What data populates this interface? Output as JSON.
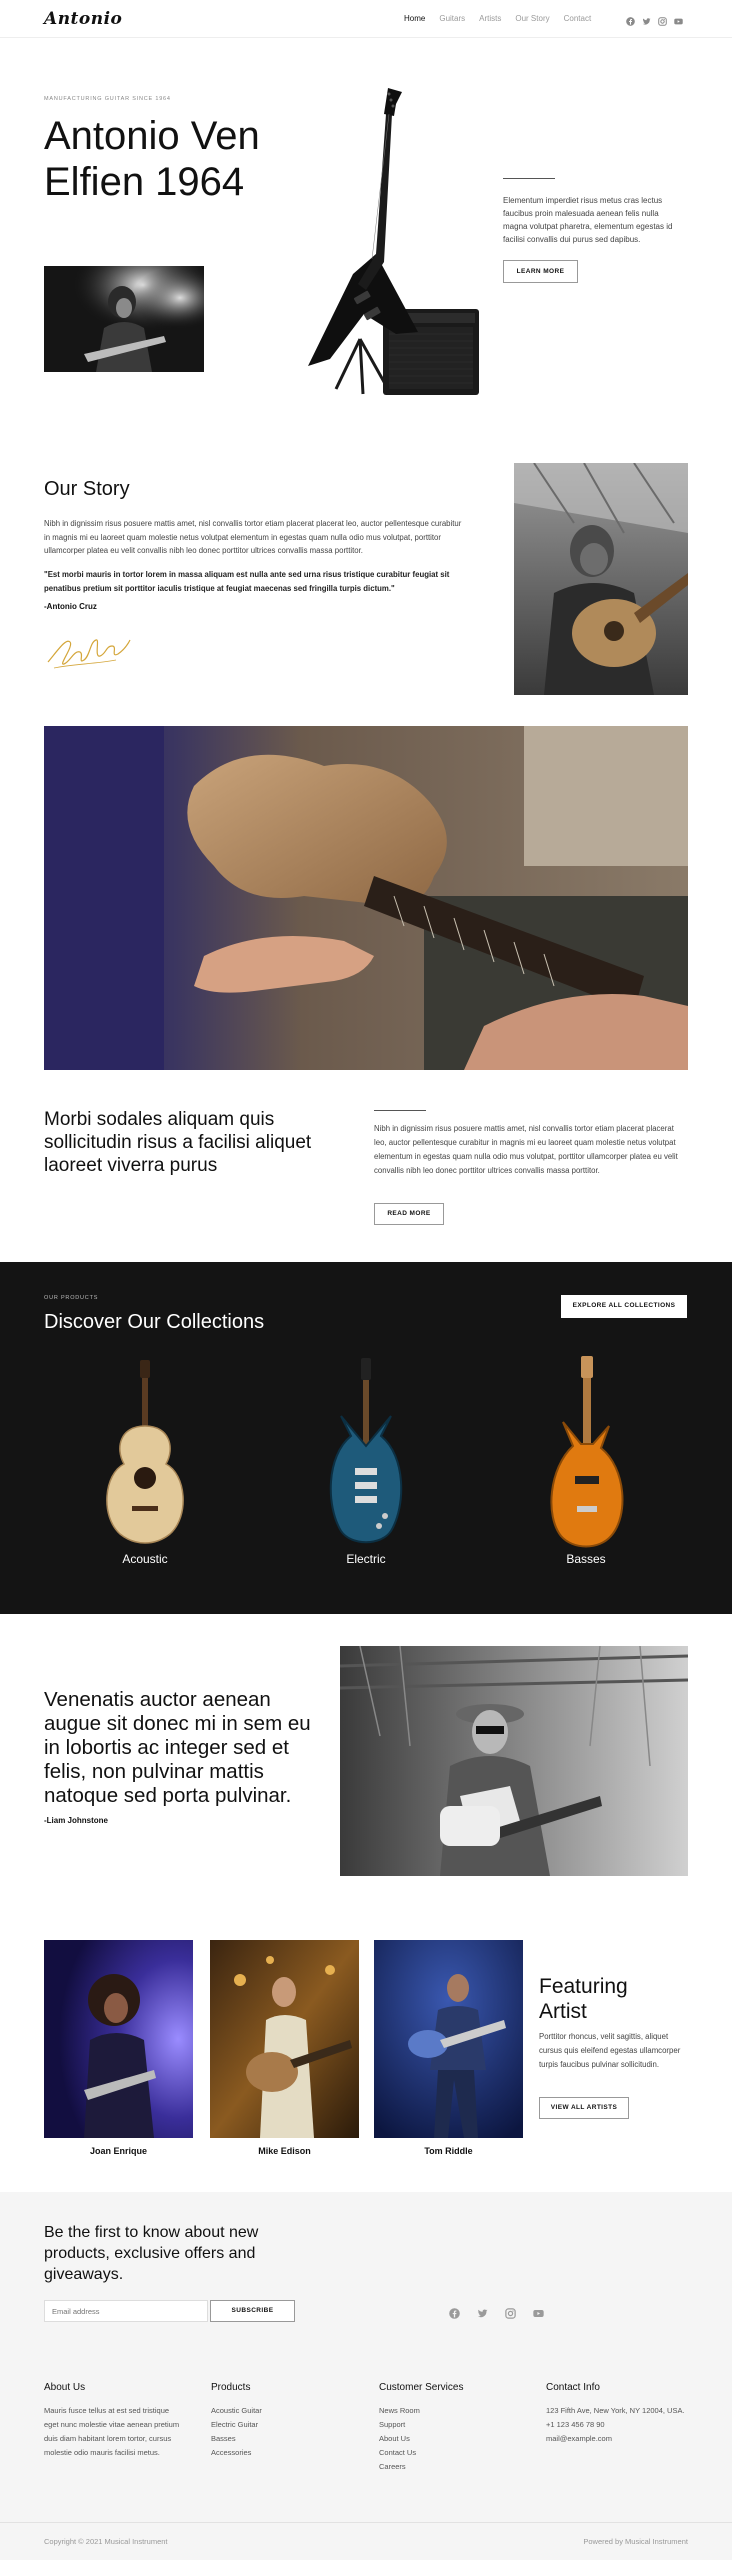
{
  "header": {
    "logo": "Antonio",
    "nav": [
      "Home",
      "Guitars",
      "Artists",
      "Our Story",
      "Contact"
    ],
    "social_icons": [
      "facebook-icon",
      "twitter-icon",
      "instagram-icon",
      "youtube-icon"
    ]
  },
  "hero": {
    "eyebrow": "MANUFACTURING GUITAR SINCE 1964",
    "title": "Antonio Ven Elfien 1964",
    "text": "Elementum imperdiet risus metus cras lectus faucibus proin malesuada aenean felis nulla magna volutpat pharetra, elementum egestas id facilisi convallis dui purus sed dapibus.",
    "button": "LEARN MORE"
  },
  "story": {
    "title": "Our Story",
    "paragraph": "Nibh in dignissim risus posuere mattis amet, nisl convallis tortor etiam placerat placerat leo, auctor pellentesque curabitur in magnis mi eu laoreet quam molestie netus volutpat elementum in egestas quam nulla odio mus volutpat, porttitor ullamcorper platea eu velit convallis nibh leo donec porttitor ultrices convallis massa porttitor.",
    "quote": "\"Est morbi mauris in tortor lorem in massa aliquam est nulla ante sed urna risus tristique curabitur feugiat sit penatibus pretium sit porttitor iaculis tristique at feugiat maecenas sed fringilla turpis dictum.\"",
    "author": "-Antonio Cruz"
  },
  "morbi": {
    "title": "Morbi sodales aliquam quis sollicitudin risus a facilisi aliquet laoreet viverra purus",
    "text": "Nibh in dignissim risus posuere mattis amet, nisl convallis tortor etiam placerat placerat leo, auctor pellentesque curabitur in magnis mi eu laoreet quam molestie netus volutpat elementum in egestas quam nulla odio mus volutpat, porttitor ullamcorper platea eu velit convallis nibh leo donec porttitor ultrices convallis massa porttitor.",
    "button": "READ MORE"
  },
  "collections": {
    "eyebrow": "OUR PRODUCTS",
    "title": "Discover Our Collections",
    "button": "EXPLORE ALL COLLECTIONS",
    "items": [
      {
        "label": "Acoustic",
        "color": "#e2c99a"
      },
      {
        "label": "Electric",
        "color": "#1e5a7a"
      },
      {
        "label": "Basses",
        "color": "#e07a10"
      }
    ]
  },
  "quote": {
    "text": "Venenatis auctor aenean augue sit donec mi in sem eu in lobortis ac integer sed et felis, non pulvinar mattis natoque sed porta pulvinar.",
    "author": "-Liam Johnstone"
  },
  "artists": {
    "names": [
      "Joan Enrique",
      "Mike Edison",
      "Tom Riddle"
    ],
    "title": "Featuring Artist",
    "text": "Porttitor rhoncus, velit sagittis, aliquet cursus quis eleifend egestas ullamcorper turpis faucibus pulvinar sollicitudin.",
    "button": "VIEW ALL ARTISTS"
  },
  "newsletter": {
    "title": "Be the first to know about new products, exclusive offers and giveaways.",
    "placeholder": "Email address",
    "button": "SUBSCRIBE"
  },
  "footer": {
    "about_title": "About Us",
    "about_text": "Mauris fusce tellus at est sed tristique eget nunc molestie vitae aenean pretium duis diam habitant lorem tortor, cursus molestie odio mauris facilisi metus.",
    "products_title": "Products",
    "products": [
      "Acoustic Guitar",
      "Electric Guitar",
      "Basses",
      "Accessories"
    ],
    "service_title": "Customer Services",
    "service": [
      "News Room",
      "Support",
      "About Us",
      "Contact Us",
      "Careers"
    ],
    "contact_title": "Contact Info",
    "contact": [
      "123 Fifth Ave, New York, NY 12004, USA.",
      "+1 123 456 78 90",
      "mail@example.com"
    ],
    "copyright": "Copyright © 2021 Musical Instrument",
    "powered": "Powered by Musical Instrument"
  }
}
